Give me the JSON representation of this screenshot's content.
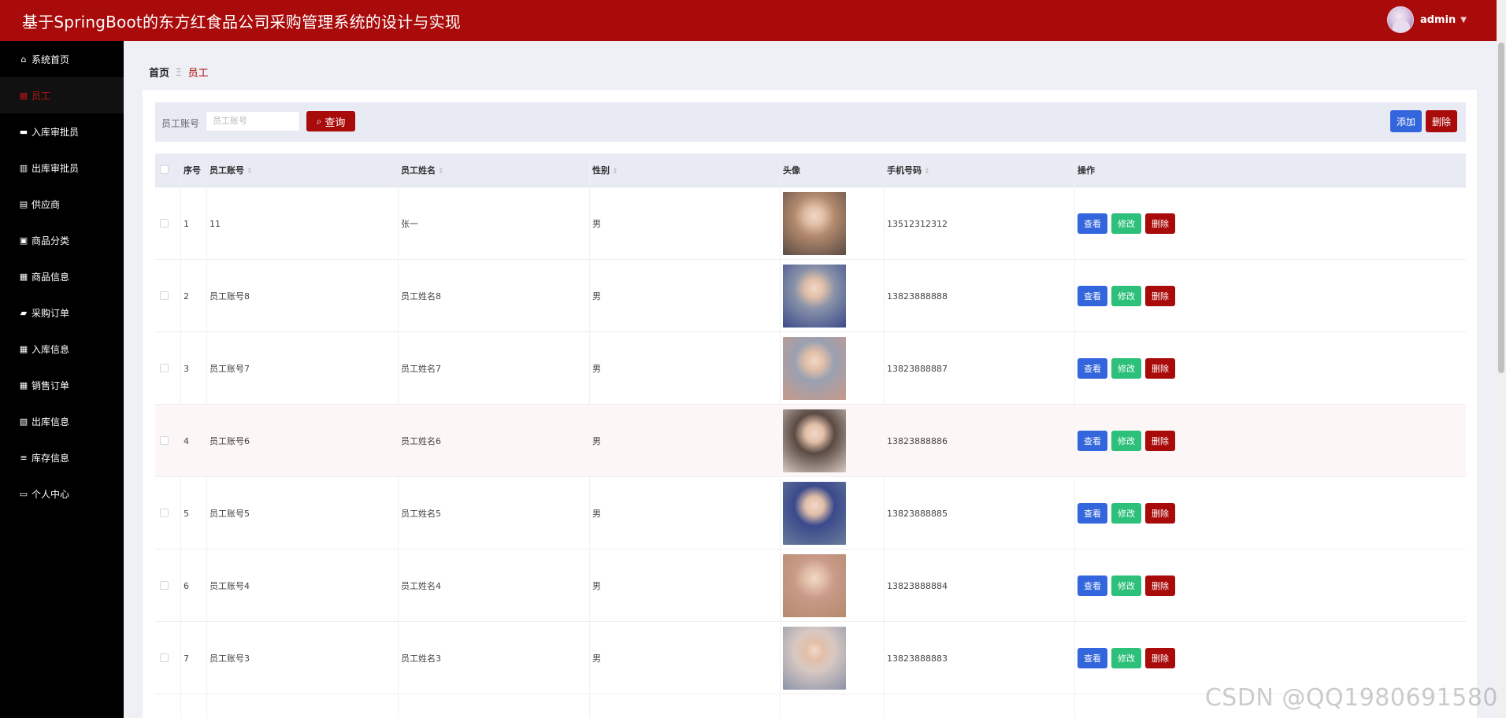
{
  "header": {
    "title": "基于SpringBoot的东方红食品公司采购管理系统的设计与实现",
    "user_name": "admin",
    "caret_icon": "caret-down-icon"
  },
  "sidebar": {
    "items": [
      {
        "label": "系统首页",
        "icon": "home-icon",
        "glyph": "⌂",
        "active": false
      },
      {
        "label": "员工",
        "icon": "grid-icon",
        "glyph": "▦",
        "active": true
      },
      {
        "label": "入库审批员",
        "icon": "truck-icon",
        "glyph": "▬",
        "active": false
      },
      {
        "label": "出库审批员",
        "icon": "bar-chart-icon",
        "glyph": "▥",
        "active": false
      },
      {
        "label": "供应商",
        "icon": "clipboard-icon",
        "glyph": "▤",
        "active": false
      },
      {
        "label": "商品分类",
        "icon": "briefcase-icon",
        "glyph": "▣",
        "active": false
      },
      {
        "label": "商品信息",
        "icon": "grid-icon",
        "glyph": "▦",
        "active": false
      },
      {
        "label": "采购订单",
        "icon": "thumbs-up-icon",
        "glyph": "▰",
        "active": false
      },
      {
        "label": "入库信息",
        "icon": "grid-icon",
        "glyph": "▦",
        "active": false
      },
      {
        "label": "销售订单",
        "icon": "calculator-icon",
        "glyph": "▦",
        "active": false
      },
      {
        "label": "出库信息",
        "icon": "image-icon",
        "glyph": "▧",
        "active": false
      },
      {
        "label": "库存信息",
        "icon": "list-icon",
        "glyph": "≡",
        "active": false
      },
      {
        "label": "个人中心",
        "icon": "id-card-icon",
        "glyph": "▭",
        "active": false
      }
    ]
  },
  "breadcrumb": {
    "home": "首页",
    "separator": "Ξ",
    "current": "员工"
  },
  "search": {
    "label": "员工账号",
    "placeholder": "员工账号",
    "query_label": "查询",
    "add_label": "添加",
    "delete_label": "删除"
  },
  "table": {
    "columns": [
      "序号",
      "员工账号",
      "员工姓名",
      "性别",
      "头像",
      "手机号码",
      "操作"
    ],
    "sort_glyph": "⇕",
    "rows": [
      {
        "index": "1",
        "account": "11",
        "name": "张一",
        "gender": "男",
        "phone": "13512312312",
        "highlight": false
      },
      {
        "index": "2",
        "account": "员工账号8",
        "name": "员工姓名8",
        "gender": "男",
        "phone": "13823888888",
        "highlight": false
      },
      {
        "index": "3",
        "account": "员工账号7",
        "name": "员工姓名7",
        "gender": "男",
        "phone": "13823888887",
        "highlight": false
      },
      {
        "index": "4",
        "account": "员工账号6",
        "name": "员工姓名6",
        "gender": "男",
        "phone": "13823888886",
        "highlight": true
      },
      {
        "index": "5",
        "account": "员工账号5",
        "name": "员工姓名5",
        "gender": "男",
        "phone": "13823888885",
        "highlight": false
      },
      {
        "index": "6",
        "account": "员工账号4",
        "name": "员工姓名4",
        "gender": "男",
        "phone": "13823888884",
        "highlight": false
      },
      {
        "index": "7",
        "account": "员工账号3",
        "name": "员工姓名3",
        "gender": "男",
        "phone": "13823888883",
        "highlight": false
      }
    ],
    "actions": {
      "view": "查看",
      "edit": "修改",
      "delete": "删除"
    }
  },
  "colors": {
    "brand_red": "#a90a0a",
    "primary_blue": "#3366dd",
    "success_green": "#2cc07a",
    "sidebar_bg": "#000000",
    "photo_tones": [
      "#b38a6e",
      "#8a93a8",
      "#9aa0b2",
      "#5a4a44",
      "#3a4a8c",
      "#c99a88",
      "#d8c8c2",
      "#6a7c9a"
    ]
  },
  "watermark": "CSDN @QQ1980691580"
}
